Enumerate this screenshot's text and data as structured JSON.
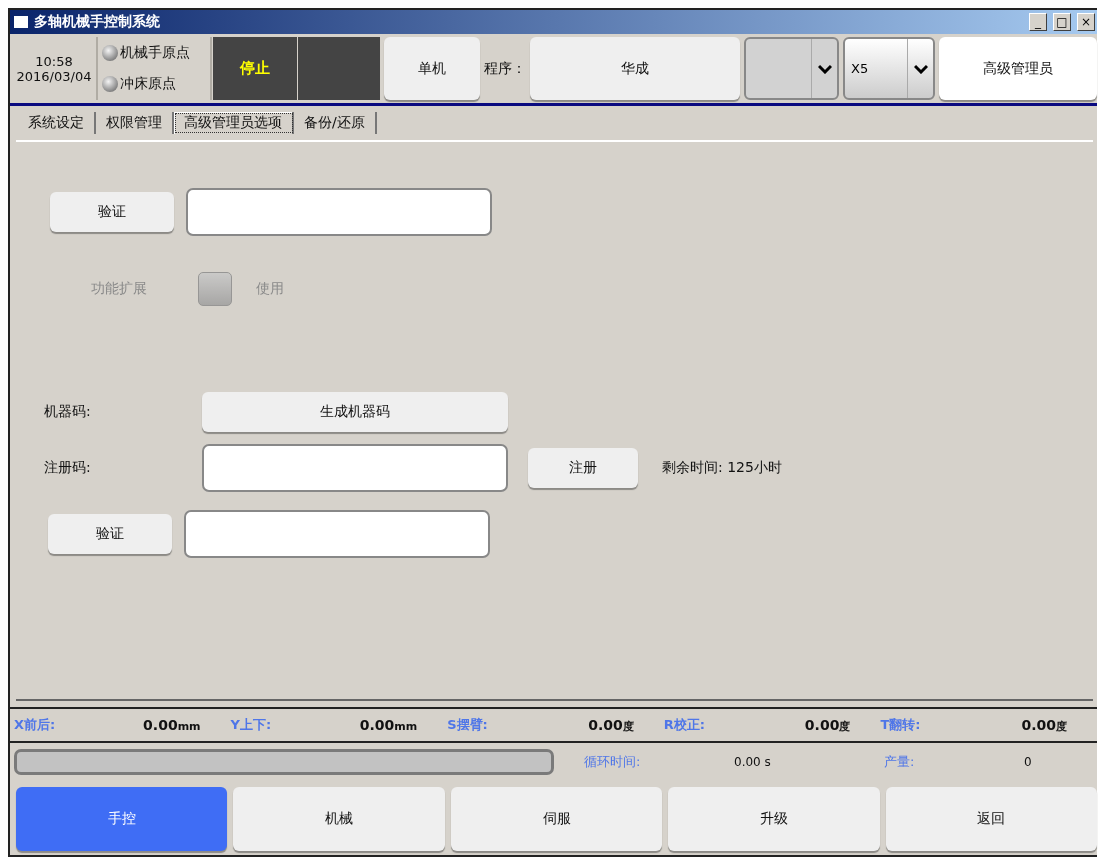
{
  "window": {
    "title": "多轴机械手控制系统",
    "controls": [
      "_",
      "□",
      "×"
    ]
  },
  "header": {
    "time": "10:58",
    "date": "2016/03/04",
    "indicators": [
      {
        "label": "机械手原点",
        "on": false
      },
      {
        "label": "冲床原点",
        "on": false
      }
    ],
    "status": "停止",
    "mode_button": "单机",
    "program_label": "程序：",
    "program_name": "华成",
    "dropdowns": [
      {
        "kind": "blank"
      },
      {
        "kind": "select",
        "value": "X5"
      }
    ],
    "user": "高级管理员"
  },
  "tabs": [
    {
      "label": "系统设定",
      "selected": false
    },
    {
      "label": "权限管理",
      "selected": false
    },
    {
      "label": "高级管理员选项",
      "selected": true
    },
    {
      "label": "备份/还原",
      "selected": false
    }
  ],
  "admin": {
    "verify_button": "验证",
    "feature": {
      "label": "功能扩展",
      "checkbox_label": "使用",
      "checked": false,
      "disabled": true
    }
  },
  "registration": {
    "machine_code_label": "机器码:",
    "generate_button": "生成机器码",
    "register_label": "注册码:",
    "register_button": "注册",
    "remaining": "剩余时间: 125小时",
    "verify_button": "验证"
  },
  "axes": [
    {
      "label": "X前后:",
      "value": "0.00",
      "unit": "mm"
    },
    {
      "label": "Y上下:",
      "value": "0.00",
      "unit": "mm"
    },
    {
      "label": "S摆臂:",
      "value": "0.00",
      "unit": "度"
    },
    {
      "label": "R校正:",
      "value": "0.00",
      "unit": "度"
    },
    {
      "label": "T翻转:",
      "value": "0.00",
      "unit": "度"
    }
  ],
  "progress": {
    "level": 0
  },
  "cycle": {
    "label": "循环时间:",
    "value": "0.00 s"
  },
  "output": {
    "label": "产量:",
    "value": "0"
  },
  "nav": [
    {
      "label": "手控",
      "selected": true
    },
    {
      "label": "机械",
      "selected": false
    },
    {
      "label": "伺服",
      "selected": false
    },
    {
      "label": "升级",
      "selected": false
    },
    {
      "label": "返回",
      "selected": false
    }
  ]
}
